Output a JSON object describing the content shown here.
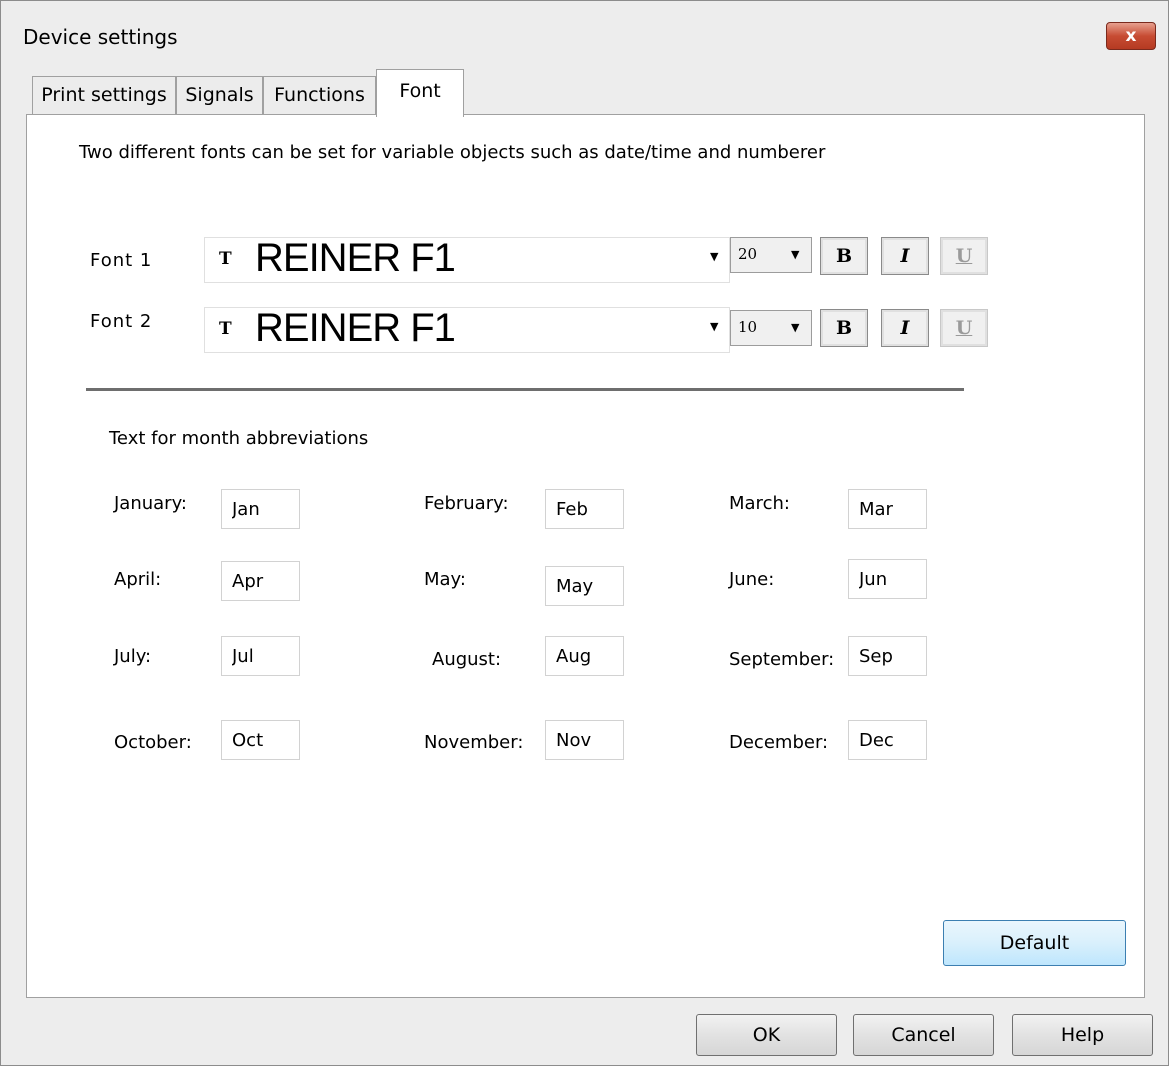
{
  "window": {
    "title": "Device settings",
    "close_label": "x"
  },
  "tabs": [
    {
      "label": "Print settings"
    },
    {
      "label": "Signals"
    },
    {
      "label": "Functions"
    },
    {
      "label": "Font",
      "active": true
    }
  ],
  "font_panel": {
    "description": "Two different fonts can be set for variable objects such as date/time and numberer",
    "font1": {
      "label": "Font 1",
      "icon": "truetype-font-icon",
      "font_name": "REINER F1",
      "size": "20",
      "bold": "B",
      "italic": "I",
      "underline": "U"
    },
    "font2": {
      "label": "Font 2",
      "icon": "truetype-font-icon",
      "font_name": "REINER F1",
      "size": "10",
      "bold": "B",
      "italic": "I",
      "underline": "U"
    }
  },
  "months": {
    "section_title": "Text for month abbreviations",
    "items": [
      {
        "label": "January:",
        "value": "Jan"
      },
      {
        "label": "February:",
        "value": "Feb"
      },
      {
        "label": "March:",
        "value": "Mar"
      },
      {
        "label": "April:",
        "value": "Apr"
      },
      {
        "label": "May:",
        "value": "May"
      },
      {
        "label": "June:",
        "value": "Jun"
      },
      {
        "label": "July:",
        "value": "Jul"
      },
      {
        "label": "August:",
        "value": "Aug"
      },
      {
        "label": "September:",
        "value": "Sep"
      },
      {
        "label": "October:",
        "value": "Oct"
      },
      {
        "label": "November:",
        "value": "Nov"
      },
      {
        "label": "December:",
        "value": "Dec"
      }
    ]
  },
  "buttons": {
    "default": "Default",
    "ok": "OK",
    "cancel": "Cancel",
    "help": "Help"
  },
  "colors": {
    "close_button": "#c74c33",
    "default_button": "#bee6fd",
    "window_bg": "#ededed"
  }
}
